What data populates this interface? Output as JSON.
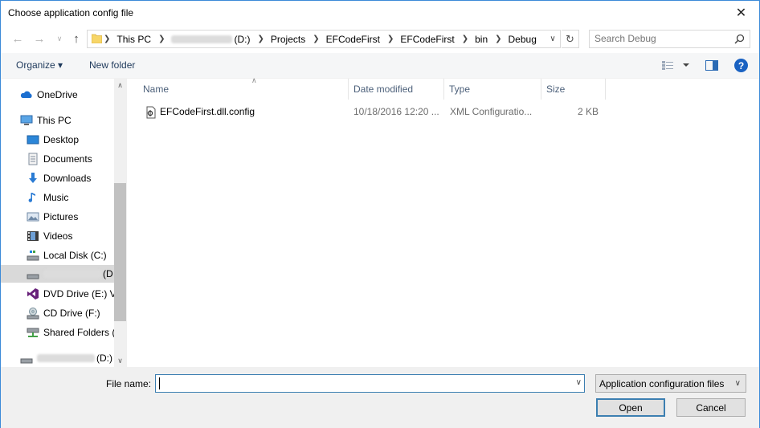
{
  "window": {
    "title": "Choose application config file",
    "close_glyph": "✕"
  },
  "address": {
    "crumbs": [
      {
        "label": "This PC"
      },
      {
        "label": "(D:)",
        "blurred_prefix": true
      },
      {
        "label": "Projects"
      },
      {
        "label": "EFCodeFirst"
      },
      {
        "label": "EFCodeFirst"
      },
      {
        "label": "bin"
      },
      {
        "label": "Debug"
      }
    ]
  },
  "search": {
    "placeholder": "Search Debug"
  },
  "toolbar": {
    "organize": "Organize ▾",
    "new_folder": "New folder",
    "help": "?"
  },
  "nav": {
    "items": [
      {
        "label": "OneDrive",
        "icon": "cloud-icon"
      },
      {
        "label": "This PC",
        "icon": "computer-icon"
      },
      {
        "label": "Desktop",
        "icon": "desktop-icon"
      },
      {
        "label": "Documents",
        "icon": "documents-icon"
      },
      {
        "label": "Downloads",
        "icon": "download-icon"
      },
      {
        "label": "Music",
        "icon": "music-icon"
      },
      {
        "label": "Pictures",
        "icon": "pictures-icon"
      },
      {
        "label": "Videos",
        "icon": "videos-icon"
      },
      {
        "label": "Local Disk (C:)",
        "icon": "drive-icon"
      },
      {
        "label": "(D",
        "icon": "drive-icon",
        "blurred_prefix": true,
        "selected": true
      },
      {
        "label": "DVD Drive (E:) VS",
        "icon": "visual-studio-icon"
      },
      {
        "label": "CD Drive (F:)",
        "icon": "cd-drive-icon"
      },
      {
        "label": "Shared Folders (\\",
        "icon": "network-drive-icon"
      },
      {
        "label": "(D:)",
        "icon": "drive-icon",
        "blurred_prefix": true
      }
    ]
  },
  "columns": {
    "name": "Name",
    "date": "Date modified",
    "type": "Type",
    "size": "Size"
  },
  "files": [
    {
      "name": "EFCodeFirst.dll.config",
      "date": "10/18/2016 12:20 ...",
      "type": "XML Configuratio...",
      "size": "2 KB",
      "icon": "config-file-icon"
    }
  ],
  "bottom": {
    "file_name_label": "File name:",
    "file_name_value": "",
    "filter_selected": "Application configuration files",
    "open": "Open",
    "cancel": "Cancel"
  }
}
